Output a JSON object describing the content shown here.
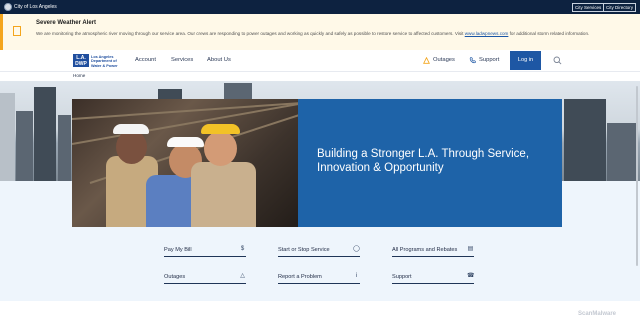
{
  "topbar": {
    "city_name": "City of Los Angeles",
    "links": [
      "City Services",
      "City Directory"
    ]
  },
  "alert": {
    "title": "Severe Weather Alert",
    "text_before": "We are monitoring the atmospheric river moving through our service area. Our crews are responding to power outages and working as quickly and safely as possible to restore service to affected customers. Visit",
    "link": "www.ladwpnews.com",
    "text_after": "for additional storm related information."
  },
  "nav": {
    "logo_mark": "L.A.\nDWP",
    "logo_text": "Los Angeles Department of Water & Power",
    "items": [
      "Account",
      "Services",
      "About Us"
    ],
    "outages": "Outages",
    "support": "Support",
    "login": "Log in"
  },
  "breadcrumb": "Home",
  "hero": {
    "title": "Building a Stronger L.A. Through Service, Innovation & Opportunity"
  },
  "quick_links": [
    {
      "label": "Pay My Bill",
      "icon": "dollar-icon",
      "glyph": "$"
    },
    {
      "label": "Start or Stop Service",
      "icon": "power-icon",
      "glyph": "◯"
    },
    {
      "label": "All Programs and Rebates",
      "icon": "rebates-icon",
      "glyph": "▤"
    },
    {
      "label": "Outages",
      "icon": "warning-icon",
      "glyph": "△"
    },
    {
      "label": "Report a Problem",
      "icon": "info-icon",
      "glyph": "i"
    },
    {
      "label": "Support",
      "icon": "phone-icon",
      "glyph": "☎"
    }
  ],
  "watermark": "ScanMalware",
  "colors": {
    "topbar": "#0d2240",
    "accent": "#1e57a4",
    "hero_panel": "#1e63a8",
    "alert_accent": "#f4a51c"
  }
}
